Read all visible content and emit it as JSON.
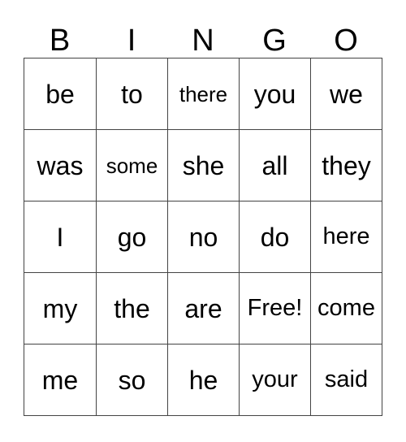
{
  "card": {
    "type": "bingo-card",
    "header": {
      "letters": [
        "B",
        "I",
        "N",
        "G",
        "O"
      ]
    },
    "free_space": {
      "label": "Free!",
      "row": 3,
      "column": 3
    },
    "colors": {
      "background": "#ffffff",
      "text": "#000000",
      "grid_line": "#444444"
    },
    "grid": {
      "rows": 5,
      "columns": 5,
      "cells": [
        [
          {
            "text": "be",
            "size": "normal"
          },
          {
            "text": "to",
            "size": "normal"
          },
          {
            "text": "there",
            "size": "small"
          },
          {
            "text": "you",
            "size": "normal"
          },
          {
            "text": "we",
            "size": "normal"
          }
        ],
        [
          {
            "text": "was",
            "size": "normal"
          },
          {
            "text": "some",
            "size": "small"
          },
          {
            "text": "she",
            "size": "normal"
          },
          {
            "text": "all",
            "size": "normal"
          },
          {
            "text": "they",
            "size": "normal"
          }
        ],
        [
          {
            "text": "I",
            "size": "normal"
          },
          {
            "text": "go",
            "size": "normal"
          },
          {
            "text": "no",
            "size": "normal"
          },
          {
            "text": "do",
            "size": "normal"
          },
          {
            "text": "here",
            "size": "medium"
          }
        ],
        [
          {
            "text": "my",
            "size": "normal"
          },
          {
            "text": "the",
            "size": "normal"
          },
          {
            "text": "are",
            "size": "normal"
          },
          {
            "text": "Free!",
            "size": "medium"
          },
          {
            "text": "come",
            "size": "medium"
          }
        ],
        [
          {
            "text": "me",
            "size": "normal"
          },
          {
            "text": "so",
            "size": "normal"
          },
          {
            "text": "he",
            "size": "normal"
          },
          {
            "text": "your",
            "size": "medium"
          },
          {
            "text": "said",
            "size": "medium"
          }
        ]
      ]
    }
  }
}
